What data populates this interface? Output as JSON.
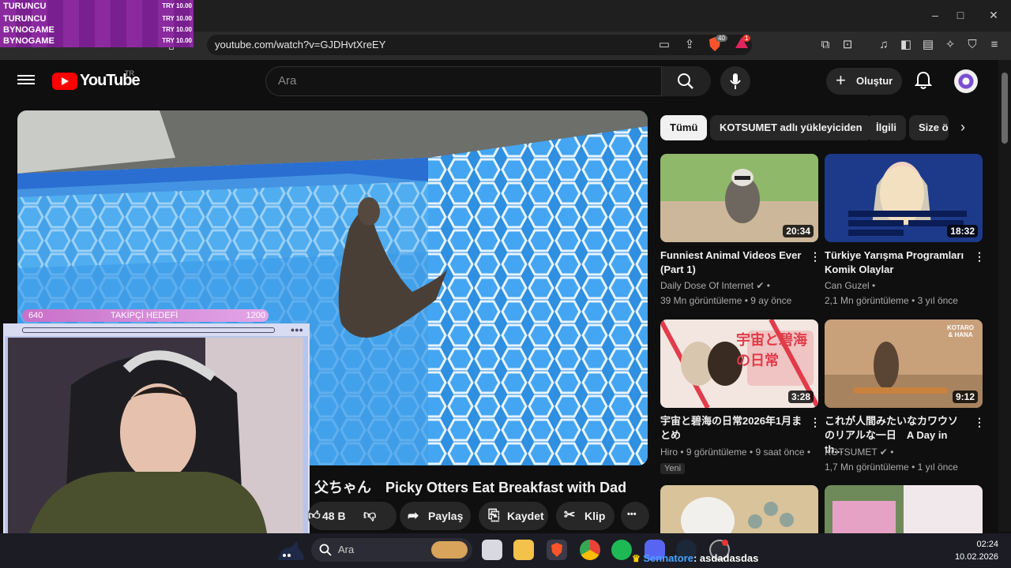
{
  "browser": {
    "url": "youtube.com/watch?v=GJDHvtXreEY",
    "brave_badge": "40",
    "alert_badge": "1",
    "window": {
      "minimize": "–",
      "maximize": "□",
      "close": "✕"
    }
  },
  "stream_overlay": {
    "alerts": [
      {
        "name": "TURUNCU",
        "amount": "TRY 10.00"
      },
      {
        "name": "TURUNCU",
        "amount": "TRY 10.00"
      },
      {
        "name": "BYNOGAME",
        "amount": "TRY 10.00"
      },
      {
        "name": "BYNOGAME",
        "amount": "TRY 10.00"
      }
    ],
    "follower_goal": {
      "current": "640",
      "label": "TAKİPÇİ HEDEFİ",
      "target": "1200",
      "progress_fraction": 0.53
    },
    "chat": {
      "user": "Sennatore",
      "message": ": asdadasdas"
    }
  },
  "youtube": {
    "logo_text": "YouTube",
    "region": "TR",
    "search_placeholder": "Ara",
    "create_label": "Oluştur",
    "video": {
      "title_jp": "父ちゃん",
      "title": "Picky Otters Eat Breakfast with Dad",
      "actions": {
        "likes": "48 B",
        "share": "Paylaş",
        "save": "Kaydet",
        "clip": "Klip",
        "more": "•••"
      }
    },
    "chips": [
      "Tümü",
      "KOTSUMET adlı yükleyiciden",
      "İlgili",
      "Size ö"
    ],
    "recommendations": [
      {
        "title": "Funniest Animal Videos Ever (Part 1)",
        "channel": "Daily Dose Of Internet",
        "verified": true,
        "views": "39 Mn görüntüleme",
        "age": "9 ay önce",
        "duration": "20:34",
        "badge": ""
      },
      {
        "title": "Türkiye Yarışma Programları Komik Olaylar",
        "channel": "Can Guzel",
        "verified": false,
        "views": "2,1 Mn görüntüleme",
        "age": "3 yıl önce",
        "duration": "18:32",
        "badge": ""
      },
      {
        "title": "宇宙と碧海の日常2026年1月まとめ",
        "channel": "Hiro",
        "verified": false,
        "views": "9 görüntüleme",
        "age": "9 saat önce",
        "duration": "3:28",
        "badge": "Yeni"
      },
      {
        "title": "これが人間みたいなカワウソのリアルな一日　A Day in th...",
        "channel": "KOTSUMET",
        "verified": true,
        "views": "1,7 Mn görüntüleme",
        "age": "1 yıl önce",
        "duration": "9:12",
        "badge": ""
      }
    ],
    "thumb_text": {
      "kotaro": "KOTARO & HANA",
      "jp_overlay": "宇宙と碧海の日常"
    }
  },
  "taskbar": {
    "search_placeholder": "Ara",
    "time": "02:24",
    "date": "10.02.2026"
  },
  "colors": {
    "yt_red": "#ff0000",
    "bg": "#0f0f0f",
    "alert_purple": "#8a2a9e"
  }
}
